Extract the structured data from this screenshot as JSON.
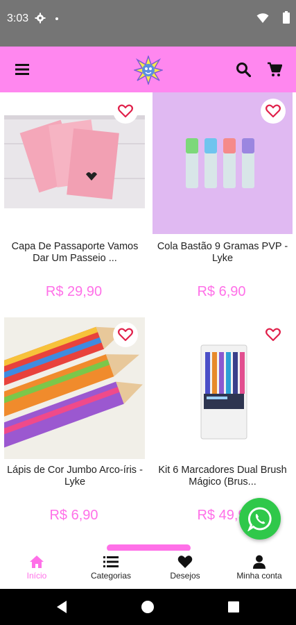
{
  "status_bar": {
    "time": "3:03",
    "icons": [
      "gear-icon",
      "dot-icon",
      "wifi-icon",
      "battery-icon"
    ]
  },
  "header": {
    "icons": [
      "menu-icon",
      "logo",
      "search-icon",
      "cart-icon"
    ],
    "color": "#ff87ef"
  },
  "products": [
    {
      "name": "Capa De Passaporte Vamos Dar Um Passeio ...",
      "price": "R$ 29,90",
      "image": "pink-passport-cover-photo"
    },
    {
      "name": "Cola Bastão 9 Gramas PVP - Lyke",
      "price": "R$ 6,90",
      "image": "glue-sticks-photo"
    },
    {
      "name": "Lápis de Cor Jumbo Arco-íris - Lyke",
      "price": "R$ 6,90",
      "image": "rainbow-pencils-photo"
    },
    {
      "name": "Kit 6 Marcadores Dual Brush Mágico (Brus...",
      "price": "R$ 49,9",
      "image": "markers-kit-photo"
    }
  ],
  "bottom_nav": {
    "items": [
      {
        "label": "Início",
        "icon": "home-icon",
        "active": true
      },
      {
        "label": "Categorias",
        "icon": "list-icon",
        "active": false
      },
      {
        "label": "Desejos",
        "icon": "heart-icon",
        "active": false
      },
      {
        "label": "Minha conta",
        "icon": "user-icon",
        "active": false
      }
    ]
  },
  "colors": {
    "accent": "#ff70e8",
    "heart": "#e0204a",
    "whatsapp": "#2fc84a"
  }
}
